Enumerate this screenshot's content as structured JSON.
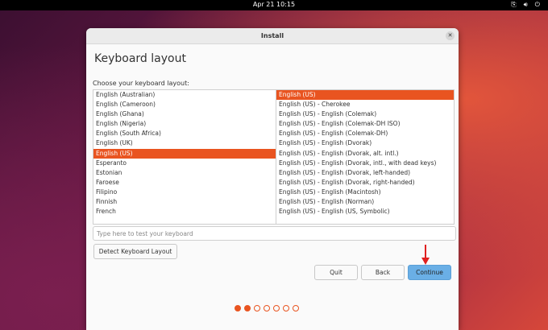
{
  "topbar": {
    "clock": "Apr 21  10:15"
  },
  "window": {
    "title": "Install"
  },
  "page": {
    "heading": "Keyboard layout",
    "prompt": "Choose your keyboard layout:"
  },
  "layouts": [
    {
      "label": "English (Australian)",
      "selected": false
    },
    {
      "label": "English (Cameroon)",
      "selected": false
    },
    {
      "label": "English (Ghana)",
      "selected": false
    },
    {
      "label": "English (Nigeria)",
      "selected": false
    },
    {
      "label": "English (South Africa)",
      "selected": false
    },
    {
      "label": "English (UK)",
      "selected": false
    },
    {
      "label": "English (US)",
      "selected": true
    },
    {
      "label": "Esperanto",
      "selected": false
    },
    {
      "label": "Estonian",
      "selected": false
    },
    {
      "label": "Faroese",
      "selected": false
    },
    {
      "label": "Filipino",
      "selected": false
    },
    {
      "label": "Finnish",
      "selected": false
    },
    {
      "label": "French",
      "selected": false
    }
  ],
  "variants": [
    {
      "label": "English (US)",
      "selected": true
    },
    {
      "label": "English (US) - Cherokee",
      "selected": false
    },
    {
      "label": "English (US) - English (Colemak)",
      "selected": false
    },
    {
      "label": "English (US) - English (Colemak-DH ISO)",
      "selected": false
    },
    {
      "label": "English (US) - English (Colemak-DH)",
      "selected": false
    },
    {
      "label": "English (US) - English (Dvorak)",
      "selected": false
    },
    {
      "label": "English (US) - English (Dvorak, alt. intl.)",
      "selected": false
    },
    {
      "label": "English (US) - English (Dvorak, intl., with dead keys)",
      "selected": false
    },
    {
      "label": "English (US) - English (Dvorak, left-handed)",
      "selected": false
    },
    {
      "label": "English (US) - English (Dvorak, right-handed)",
      "selected": false
    },
    {
      "label": "English (US) - English (Macintosh)",
      "selected": false
    },
    {
      "label": "English (US) - English (Norman)",
      "selected": false
    },
    {
      "label": "English (US) - English (US, Symbolic)",
      "selected": false
    }
  ],
  "test_field": {
    "placeholder": "Type here to test your keyboard",
    "value": ""
  },
  "buttons": {
    "detect": "Detect Keyboard Layout",
    "quit": "Quit",
    "back": "Back",
    "continue": "Continue"
  },
  "progress": {
    "total_steps": 7,
    "completed_steps": 2
  },
  "colors": {
    "accent": "#e95420",
    "continue_bg": "#6aafe6",
    "annotation_arrow": "#e02020"
  },
  "icons": {
    "network": "network-icon",
    "sound": "volume-icon",
    "power": "power-icon",
    "close": "close-icon"
  }
}
